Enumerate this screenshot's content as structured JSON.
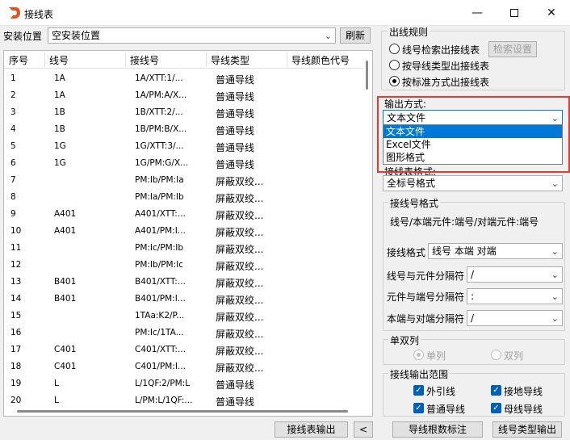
{
  "window": {
    "title": "接线表"
  },
  "top": {
    "location_label": "安装位置",
    "location_value": "空安装位置",
    "refresh_label": "刷新"
  },
  "table": {
    "headers": [
      "序号",
      "线号",
      "接线号",
      "导线类型",
      "导线颜色代号"
    ],
    "rows": [
      [
        "1",
        "1A",
        "1A/XTT:1/...",
        "普通导线"
      ],
      [
        "2",
        "1A",
        "1A/PM:A/X...",
        "普通导线"
      ],
      [
        "3",
        "1B",
        "1B/XTT:2/...",
        "普通导线"
      ],
      [
        "4",
        "1B",
        "1B/PM:B/X...",
        "普通导线"
      ],
      [
        "5",
        "1G",
        "1G/XTT:3/...",
        "普通导线"
      ],
      [
        "6",
        "1G",
        "1G/PM:G/X...",
        "普通导线"
      ],
      [
        "7",
        "",
        "PM:Ib/PM:Ia",
        "屏蔽双绞..."
      ],
      [
        "8",
        "",
        "PM:Ia/PM:Ib",
        "屏蔽双绞..."
      ],
      [
        "9",
        "A401",
        "A401/XTT:...",
        "屏蔽双绞..."
      ],
      [
        "10",
        "A401",
        "A401/PM:I...",
        "屏蔽双绞..."
      ],
      [
        "11",
        "",
        "PM:Ic/PM:Ib",
        "屏蔽双绞..."
      ],
      [
        "12",
        "",
        "PM:Ib/PM:Ic",
        "屏蔽双绞..."
      ],
      [
        "13",
        "B401",
        "B401/XTT:...",
        "屏蔽双绞..."
      ],
      [
        "14",
        "B401",
        "B401/PM:I...",
        "屏蔽双绞..."
      ],
      [
        "15",
        "",
        "1TAa:K2/P...",
        "屏蔽双绞..."
      ],
      [
        "16",
        "",
        "PM:Ic/1TA...",
        "屏蔽双绞..."
      ],
      [
        "17",
        "C401",
        "C401/XTT:...",
        "屏蔽双绞..."
      ],
      [
        "18",
        "C401",
        "C401/PM:I...",
        "屏蔽双绞..."
      ],
      [
        "19",
        "L",
        "L/1QF:2/PM:L",
        "普通导线"
      ],
      [
        "20",
        "L",
        "L/PM:L/1QF:...",
        "普通导线"
      ]
    ]
  },
  "rules": {
    "title": "出线规则",
    "options": [
      "线号检索出接线表",
      "按导线类型出接线表",
      "按标准方式出接线表"
    ],
    "selected_index": 2,
    "search_settings_label": "检索设置"
  },
  "output": {
    "label": "输出方式:",
    "value": "文本文件",
    "options": [
      "文本文件",
      "Excel文件",
      "图形格式"
    ],
    "highlight_color": "#e53935"
  },
  "table_format": {
    "label": "接线表格式:",
    "value": "全标号格式"
  },
  "wire_format": {
    "title": "接线号格式",
    "description": "线号/本端元件:端号/对端元件:端号",
    "fields": [
      {
        "label": "接线格式",
        "value": "线号 本端 对端"
      },
      {
        "label": "线号与元件分隔符",
        "value": "/"
      },
      {
        "label": "元件与端号分隔符",
        "value": ":"
      },
      {
        "label": "本端与对端分隔符",
        "value": "/"
      }
    ]
  },
  "single_double": {
    "title": "单双列",
    "single": "单列",
    "double": "双列"
  },
  "range": {
    "title": "接线输出范围",
    "items": [
      "外引线",
      "接地导线",
      "普通导线",
      "母线导线"
    ]
  },
  "bottom": {
    "export_label": "接线表输出",
    "back_label": "<",
    "count_label": "导线根数标注",
    "type_export_label": "线号类型输出"
  }
}
